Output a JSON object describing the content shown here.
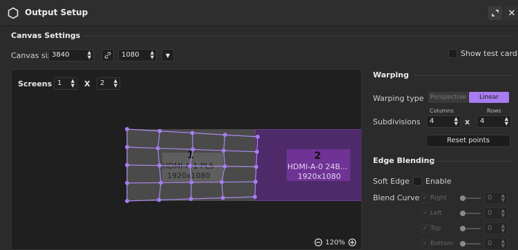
{
  "window": {
    "title": "Output Setup",
    "restore_icon": "restore-icon",
    "close_icon": "close-icon"
  },
  "canvas_settings": {
    "title": "Canvas Settings",
    "size_label": "Canvas size",
    "width": "3840",
    "height": "1080",
    "link_icon": "link-icon",
    "show_test_card_label": "Show test card"
  },
  "screens": {
    "label": "Screens",
    "rows": "1",
    "cols": "2",
    "times": "X",
    "items": [
      {
        "number": "1",
        "name": "HDMI-A-1 PL5",
        "resolution": "1920x1080"
      },
      {
        "number": "2",
        "name": "HDMI-A-0 24B...",
        "resolution": "1920x1080"
      }
    ]
  },
  "zoom": {
    "value": "120%",
    "minus_icon": "zoom-out-icon",
    "plus_icon": "zoom-in-icon"
  },
  "warping": {
    "title": "Warping",
    "type_label": "Warping type",
    "options": [
      "Perspective",
      "Linear"
    ],
    "selected": "Linear",
    "columns_label": "Columns",
    "rows_label": "Rows",
    "subdivisions_label": "Subdivisions",
    "columns": "4",
    "rows": "4",
    "times": "x",
    "reset_label": "Reset points"
  },
  "edge_blending": {
    "title": "Edge Blending",
    "soft_edge_label": "Soft Edge",
    "enable_label": "Enable",
    "blend_curve_label": "Blend Curve",
    "sides": [
      {
        "label": "Right",
        "value": "0"
      },
      {
        "label": "Left",
        "value": "0"
      },
      {
        "label": "Top",
        "value": "0"
      },
      {
        "label": "Bottom",
        "value": "0"
      }
    ]
  },
  "colors": {
    "accent": "#a87cf0",
    "screen2_fill": "#5b2f78",
    "grid_line": "#a98bef"
  }
}
